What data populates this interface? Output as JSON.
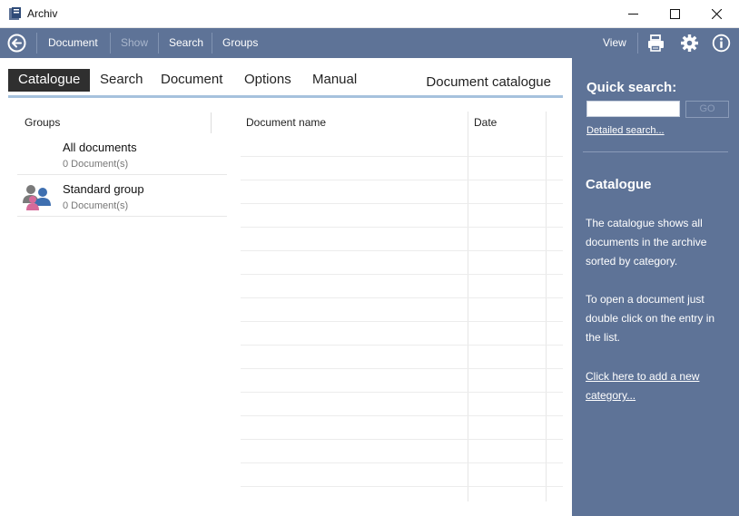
{
  "window": {
    "title": "Archiv",
    "icon": "archive-app-icon",
    "controls": [
      "minimize-icon",
      "maximize-icon",
      "close-icon"
    ]
  },
  "toolbar": {
    "back_icon": "back-arrow-icon",
    "items": [
      {
        "label": "Document",
        "enabled": true
      },
      {
        "label": "Show",
        "enabled": false
      },
      {
        "label": "Search",
        "enabled": true
      },
      {
        "label": "Groups",
        "enabled": true
      }
    ],
    "view_label": "View",
    "right_icons": [
      "print-icon",
      "settings-gear-icon",
      "info-icon"
    ]
  },
  "tabs": {
    "items": [
      {
        "label": "Catalogue",
        "active": true
      },
      {
        "label": "Search",
        "active": false
      },
      {
        "label": "Document",
        "active": false
      },
      {
        "label": "Options",
        "active": false
      },
      {
        "label": "Manual",
        "active": false
      }
    ],
    "section_title": "Document catalogue"
  },
  "groups": {
    "header": "Groups",
    "items": [
      {
        "name": "All documents",
        "count": "0 Document(s)",
        "icon": ""
      },
      {
        "name": "Standard group",
        "count": "0 Document(s)",
        "icon": "user-group-icon"
      }
    ]
  },
  "documents": {
    "columns": [
      "Document name",
      "Date"
    ],
    "rows": []
  },
  "sidepanel": {
    "quick_search": {
      "title": "Quick search:",
      "input_value": "",
      "go_label": "GO",
      "detailed_link": "Detailed search..."
    },
    "heading": "Catalogue",
    "paragraph1": "The catalogue shows all documents in the archive sorted by category.",
    "paragraph2": "To open a document just double click on the entry in the list.",
    "add_link": "Click here to add a new category..."
  },
  "colors": {
    "toolbar_bg": "#5e7397",
    "panel_bg": "#5e7397",
    "tab_active_bg": "#2f2f2f",
    "tab_underline": "#a6c2dd"
  }
}
